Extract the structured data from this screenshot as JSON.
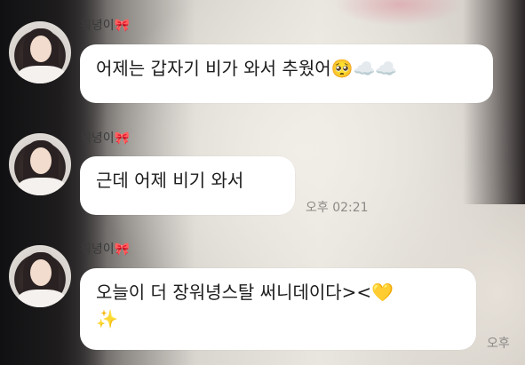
{
  "messages": [
    {
      "sender": "워녕이🎀",
      "text": "어제는 갑자기 비가 와서 추웠어🥺☁️☁️",
      "time": ""
    },
    {
      "sender": "워녕이🎀",
      "text": "근데 어제 비기 와서",
      "time": "오후 02:21"
    },
    {
      "sender": "워녕이🎀",
      "text": "오늘이 더 장워녕스탈 써니데이다><💛",
      "text_line2": "✨",
      "time": "오후"
    }
  ],
  "icons": {
    "avatar": "profile-photo-icon"
  }
}
